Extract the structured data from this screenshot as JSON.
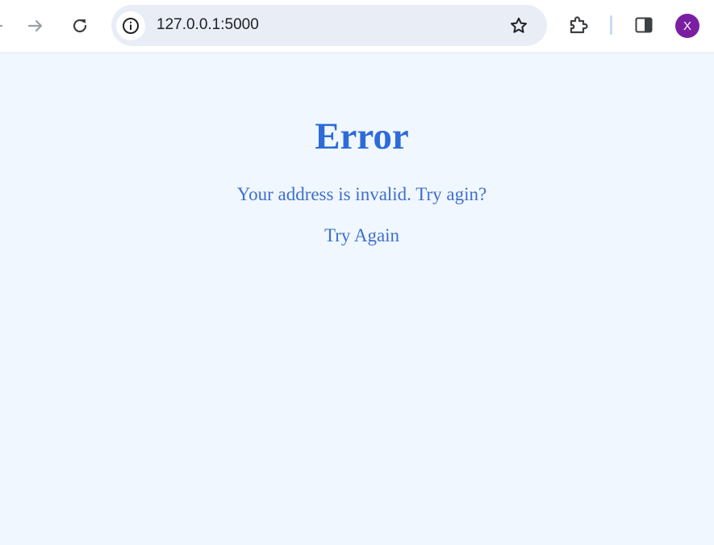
{
  "browser": {
    "url": "127.0.0.1:5000",
    "profile_initial": "X",
    "profile_color": "#7b1fa2",
    "icons": {
      "back": "arrow-left-icon",
      "forward": "arrow-right-icon",
      "reload": "reload-icon",
      "site_info": "info-icon",
      "bookmark": "star-icon",
      "extensions": "puzzle-icon",
      "side_panel": "side-panel-icon"
    }
  },
  "page": {
    "heading": "Error",
    "message": "Your address is invalid. Try agin?",
    "try_again_link": "Try Again",
    "background_color": "#f0f7ff",
    "text_color": "#2d6bd9"
  }
}
